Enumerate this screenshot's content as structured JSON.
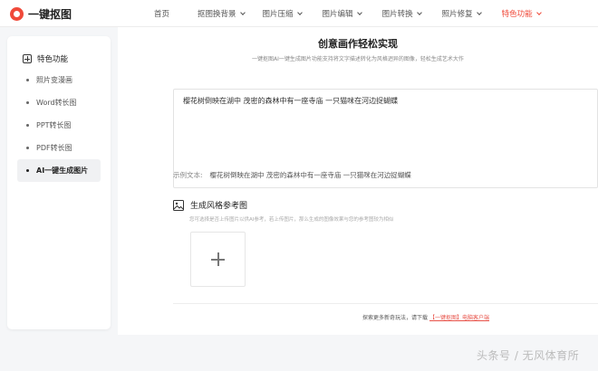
{
  "brand": {
    "name": "一键抠图"
  },
  "nav": {
    "items": [
      {
        "label": "首页",
        "has_menu": false
      },
      {
        "label": "抠图换背景",
        "has_menu": true
      },
      {
        "label": "图片压缩",
        "has_menu": true
      },
      {
        "label": "图片编辑",
        "has_menu": true
      },
      {
        "label": "图片转换",
        "has_menu": true
      },
      {
        "label": "照片修复",
        "has_menu": true
      },
      {
        "label": "特色功能",
        "has_menu": true,
        "active": true
      }
    ]
  },
  "sidebar": {
    "title": "特色功能",
    "items": [
      {
        "label": "照片变漫画",
        "active": false
      },
      {
        "label": "Word转长图",
        "active": false
      },
      {
        "label": "PPT转长图",
        "active": false
      },
      {
        "label": "PDF转长图",
        "active": false
      },
      {
        "label": "AI一键生成图片",
        "active": true
      }
    ]
  },
  "main": {
    "title": "创意画作轻松实现",
    "subtitle": "一键抠图AI一键生成图片功能支持将文字描述转化为风格迥异的图像，轻松生成艺术大作",
    "prompt_value": "樱花树倒映在湖中  茂密的森林中有一座寺庙  一只猫咪在河边捉蝴蝶",
    "example_label": "示例文本:",
    "example_value": "樱花树倒映在湖中  茂密的森林中有一座寺庙  一只猫咪在河边捉蝴蝶",
    "style_title": "生成风格参考图",
    "style_hint": "您可选择是否上传图片以供AI参考，若上传图片，那么生成的图像效果与您的参考图较为相似",
    "footer_text": "探索更多新奇玩法，请下载",
    "footer_link": "【一键抠图】电脑客户端"
  },
  "watermark": "头条号 / 无风体育所",
  "colors": {
    "accent": "#f04a3a",
    "link": "#e8534a"
  },
  "icons": {
    "logo": "logo-icon",
    "sidebar_head": "plus-square-icon",
    "style": "image-icon",
    "upload": "plus-icon",
    "nav_menu": "chevron-down-icon"
  }
}
